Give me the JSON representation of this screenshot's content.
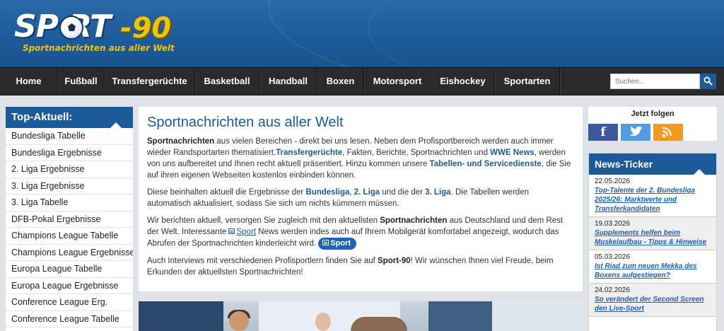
{
  "header": {
    "logo_word": "SP  RT",
    "logo_num": "-90",
    "logo_sub": "Sportnachrichten aus aller Welt"
  },
  "nav": {
    "items": [
      {
        "label": "Home"
      },
      {
        "label": "Fußball"
      },
      {
        "label": "Transfergerüchte"
      },
      {
        "label": "Basketball"
      },
      {
        "label": "Handball"
      },
      {
        "label": "Boxen"
      },
      {
        "label": "Motorsport"
      },
      {
        "label": "Eishockey"
      },
      {
        "label": "Sportarten"
      }
    ],
    "search_placeholder": "Suchen..."
  },
  "left": {
    "title": "Top-Aktuell:",
    "items": [
      "Bundesliga Tabelle",
      "Bundesliga Ergebnisse",
      "2. Liga Ergebnisse",
      "3. Liga Ergebnisse",
      "3. Liga Tabelle",
      "DFB-Pokal Ergebnisse",
      "Champions League Tabelle",
      "Champions League Ergebnisse",
      "Europa League Tabelle",
      "Europa League Ergebnisse",
      "Conference League Erg.",
      "Conference League Tabelle"
    ]
  },
  "main": {
    "title": "Sportnachrichten aus aller Welt",
    "p1": {
      "b1": "Sportnachrichten",
      "t1": " aus vielen Bereichen - direkt bei uns lesen. Neben dem Profisportbereich werden auch immer wieder Randsportarten thematisiert.",
      "a1": "Transfergerüchte",
      "t2": ", Fakten, Berichte, Sportnachrichten und ",
      "a2": "WWE News",
      "t3": ", werden von uns aufbereitet und Ihnen recht aktuell präsentiert. Hinzu kommen unsere ",
      "a3": "Tabellen- und Servicedienste",
      "t4": ", die Sie auf ihren eigenen Webseiten kostenlos einbinden können."
    },
    "p2": {
      "t1": "Diese beinhalten aktuell die Ergebnisse der ",
      "a1": "Bundesliga",
      "t2": ", ",
      "a2": "2. Liga",
      "t3": " und die der ",
      "a3": "3. Liga",
      "t4": ". Die Tabellen werden automatisch aktualisiert, sodass Sie sich um nichts kümmern müssen."
    },
    "p3": {
      "t1": "Wir berichten aktuell, versorgen Sie zugleich mit den aktuellsten ",
      "b1": "Sportnachrichten",
      "t2": " aus Deutschland und dem Rest der Welt. Interessante ",
      "a1": "Sport",
      "t3": " News werden indes auch auf Ihrem Mobilgerät komfortabel angezeigt, wodurch das Abrufen der Sportnachrichten kinderleicht wird.",
      "pill": "Sport"
    },
    "p4": {
      "t1": "Auch Interviews mit verschiedenen Profisportlern finden Sie auf ",
      "b1": "Sport-90",
      "t2": "! Wir wünschen Ihnen viel Freude, beim Erkunden der aktuellsten Sportnachrichten!"
    }
  },
  "right": {
    "follow_title": "Jetzt folgen",
    "social": [
      "f",
      "t",
      "rss"
    ],
    "ticker_title": "News-Ticker",
    "ticker": [
      {
        "date": "22.05.2026",
        "title": "Top-Talente der 2. Bundesliga 2025/26: Marktwerte und Transferkandidaten"
      },
      {
        "date": "19.03.2026",
        "title": "Supplements helfen beim Muskelaufbau - Tipps & Hinweise"
      },
      {
        "date": "05.03.2026",
        "title": "Ist Riad zum neuen Mekka des Boxens aufgestiegen?"
      },
      {
        "date": "24.02.2026",
        "title": "So verändert der Second Screen den Live-Sport"
      }
    ]
  },
  "colors": {
    "brand_blue": "#1d5a99",
    "logo_yellow": "#f2c400",
    "nav_bg": "#2a2a2a",
    "link_blue": "#1e5fb4"
  }
}
